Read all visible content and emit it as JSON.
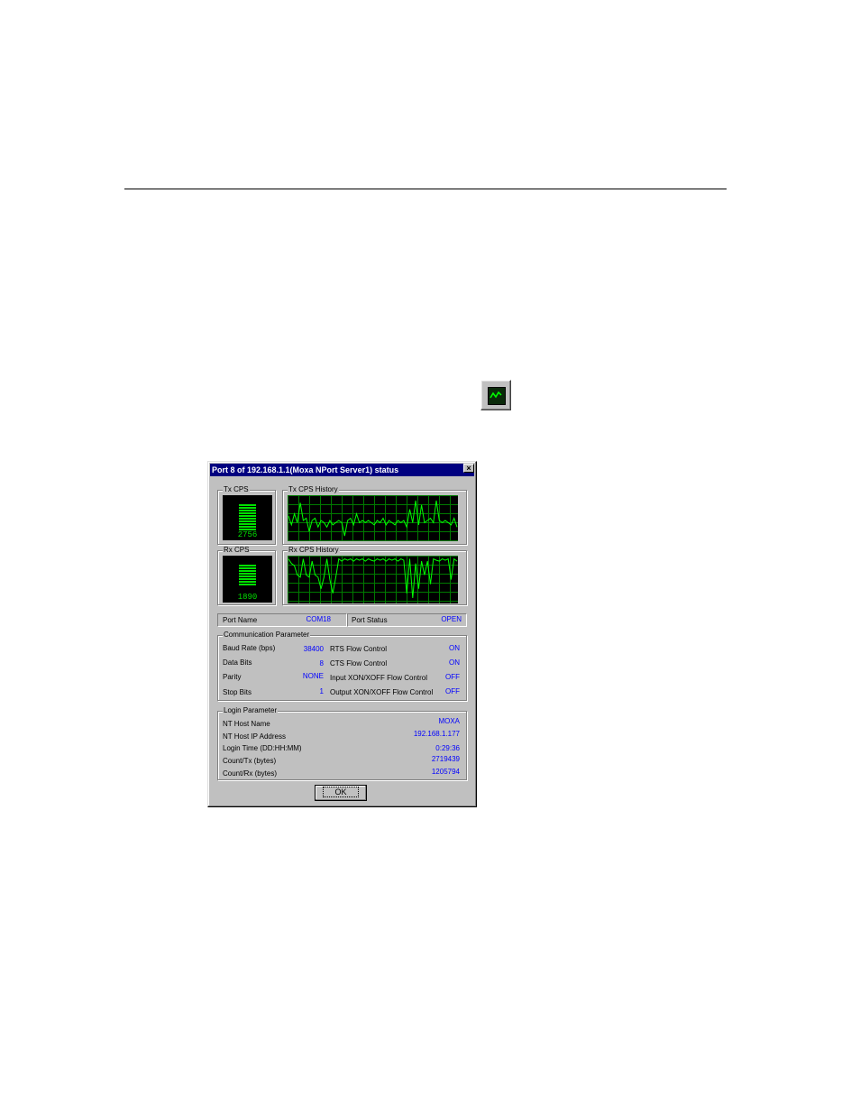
{
  "window_title": "Port 8 of 192.168.1.1(Moxa NPort Server1) status",
  "close_glyph": "×",
  "toolbar_icon": "monitor-icon",
  "tx": {
    "cps_label": "Tx CPS",
    "history_label": "Tx CPS History",
    "cps_value": "2756",
    "history": [
      0.55,
      0.35,
      0.6,
      0.4,
      0.85,
      0.45,
      0.5,
      0.2,
      0.45,
      0.5,
      0.3,
      0.45,
      0.4,
      0.3,
      0.45,
      0.35,
      0.4,
      0.45,
      0.4,
      0.1,
      0.45,
      0.5,
      0.35,
      0.6,
      0.4,
      0.45,
      0.4,
      0.45,
      0.4,
      0.35,
      0.45,
      0.4,
      0.5,
      0.35,
      0.45,
      0.4,
      0.35,
      0.45,
      0.4,
      0.45,
      0.3,
      0.7,
      0.4,
      0.9,
      0.35,
      0.8,
      0.4,
      0.45,
      0.5,
      0.4,
      0.9,
      0.45,
      0.4,
      0.45,
      0.4,
      0.35,
      0.5,
      0.3
    ]
  },
  "rx": {
    "cps_label": "Rx CPS",
    "history_label": "Rx CPS History",
    "cps_value": "1890",
    "history": [
      0.95,
      0.85,
      0.8,
      0.6,
      0.55,
      0.95,
      0.6,
      0.55,
      0.9,
      0.6,
      0.55,
      0.3,
      0.55,
      0.95,
      0.5,
      0.2,
      0.55,
      0.95,
      0.9,
      0.95,
      0.92,
      0.95,
      0.9,
      0.95,
      0.92,
      0.95,
      0.9,
      0.95,
      0.92,
      0.9,
      0.95,
      0.92,
      0.95,
      0.9,
      0.95,
      0.92,
      0.95,
      0.9,
      0.95,
      0.92,
      0.2,
      0.95,
      0.1,
      0.85,
      0.3,
      0.9,
      0.6,
      0.9,
      0.4,
      0.95,
      0.92,
      0.9,
      0.95,
      0.92,
      0.95,
      0.5,
      0.95,
      0.9
    ]
  },
  "port_name": {
    "label": "Port Name",
    "value": "COM18"
  },
  "port_status": {
    "label": "Port Status",
    "value": "OPEN"
  },
  "communication": {
    "title": "Communication Parameter",
    "left": [
      {
        "label": "Baud Rate (bps)",
        "value": "38400"
      },
      {
        "label": "Data Bits",
        "value": "8"
      },
      {
        "label": "Parity",
        "value": "NONE"
      },
      {
        "label": "Stop Bits",
        "value": "1"
      }
    ],
    "right": [
      {
        "label": "RTS Flow Control",
        "value": "ON"
      },
      {
        "label": "CTS Flow Control",
        "value": "ON"
      },
      {
        "label": "Input XON/XOFF Flow Control",
        "value": "OFF"
      },
      {
        "label": "Output XON/XOFF Flow Control",
        "value": "OFF"
      }
    ]
  },
  "login": {
    "title": "Login Parameter",
    "rows": [
      {
        "label": "NT Host Name",
        "value": "MOXA"
      },
      {
        "label": "NT Host IP Address",
        "value": "192.168.1.177"
      },
      {
        "label": "Login Time (DD:HH:MM)",
        "value": "0:29:36"
      },
      {
        "label": "Count/Tx (bytes)",
        "value": "2719439"
      },
      {
        "label": "Count/Rx (bytes)",
        "value": "1205794"
      }
    ]
  },
  "ok_label": "OK",
  "colors": {
    "title_bar": "#000080",
    "graph_line": "#00ff00",
    "value_text": "#0000ff",
    "dialog_bg": "#c0c0c0"
  }
}
